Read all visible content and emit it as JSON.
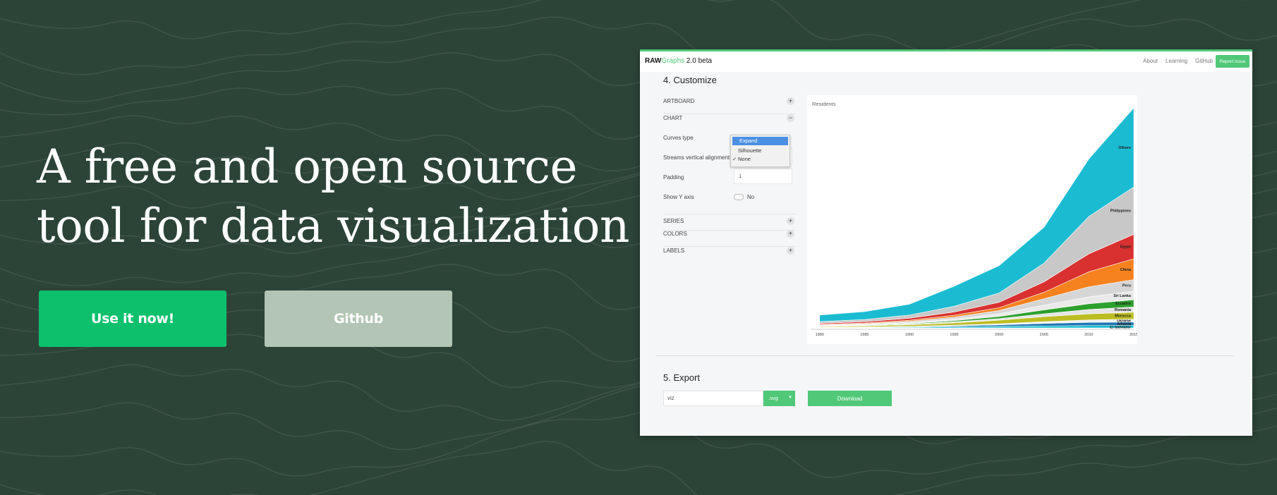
{
  "hero": {
    "title_line1": "A free and open source",
    "title_line2": "tool for data visualization",
    "primary_button": "Use it now!",
    "secondary_button": "Github"
  },
  "app": {
    "logo_bold": "RAW",
    "logo_green": "Graphs",
    "logo_version": "2.0 beta",
    "nav": [
      "About",
      "Learning",
      "GitHub"
    ],
    "report_button": "Report issue",
    "customize_title": "4. Customize",
    "sections": {
      "artboard": "ARTBOARD",
      "chart": "CHART",
      "series": "SERIES",
      "colors": "COLORS",
      "labels": "LABELS"
    },
    "chart_options": {
      "curves_type_label": "Curves type",
      "streams_alignment_label": "Streams vertical alignment",
      "padding_label": "Padding",
      "padding_value": "1",
      "show_y_axis_label": "Show Y axis",
      "show_y_axis_value": "No"
    },
    "dropdown_options": [
      "Expand",
      "Silhouette",
      "None"
    ],
    "dropdown_checked": "✓",
    "export_title": "5. Export",
    "export_filename": "viz",
    "export_format": ".svg",
    "download_button": "Download"
  },
  "colors": {
    "background": "#2c4438",
    "primary": "#0dc06c",
    "secondary": "#b3c5b5",
    "raw_green": "#50c878"
  },
  "chart_data": {
    "type": "area",
    "title": "Residents",
    "x": [
      1980,
      1985,
      1990,
      1995,
      2000,
      2005,
      2010,
      2015
    ],
    "xlim": [
      1979,
      2015
    ],
    "series": [
      {
        "name": "Others",
        "color": "#1bbcd2",
        "values": [
          90,
          110,
          150,
          280,
          380,
          500,
          800,
          1100
        ]
      },
      {
        "name": "Philippines",
        "color": "#c8c8c8",
        "values": [
          25,
          30,
          45,
          80,
          130,
          260,
          520,
          660
        ]
      },
      {
        "name": "Egypt",
        "color": "#d93030",
        "values": [
          14,
          18,
          28,
          45,
          75,
          145,
          250,
          340
        ]
      },
      {
        "name": "China",
        "color": "#f5821f",
        "values": [
          8,
          10,
          15,
          25,
          40,
          90,
          210,
          290
        ]
      },
      {
        "name": "Peru",
        "color": "#d6d6d6",
        "values": [
          10,
          12,
          18,
          28,
          44,
          90,
          140,
          160
        ]
      },
      {
        "name": "Sri Lanka",
        "color": "#eaeaea",
        "values": [
          6,
          8,
          12,
          22,
          38,
          65,
          95,
          120
        ]
      },
      {
        "name": "Ecuador",
        "color": "#2ca02c",
        "values": [
          4,
          6,
          9,
          16,
          30,
          55,
          80,
          100
        ]
      },
      {
        "name": "Romania",
        "color": "#e5e5e5",
        "values": [
          3,
          5,
          8,
          14,
          22,
          40,
          60,
          75
        ]
      },
      {
        "name": "Morocco",
        "color": "#bcbd22",
        "values": [
          10,
          14,
          22,
          34,
          50,
          70,
          85,
          95
        ]
      },
      {
        "name": "Ukraine",
        "color": "#f0f0f0",
        "values": [
          2,
          3,
          5,
          9,
          15,
          24,
          34,
          40
        ]
      },
      {
        "name": "Albania",
        "color": "#1f77b4",
        "values": [
          2,
          4,
          8,
          14,
          22,
          35,
          45,
          48
        ]
      },
      {
        "name": "El Salvador",
        "color": "#17becf",
        "values": [
          4,
          6,
          9,
          14,
          20,
          27,
          32,
          34
        ]
      }
    ]
  }
}
